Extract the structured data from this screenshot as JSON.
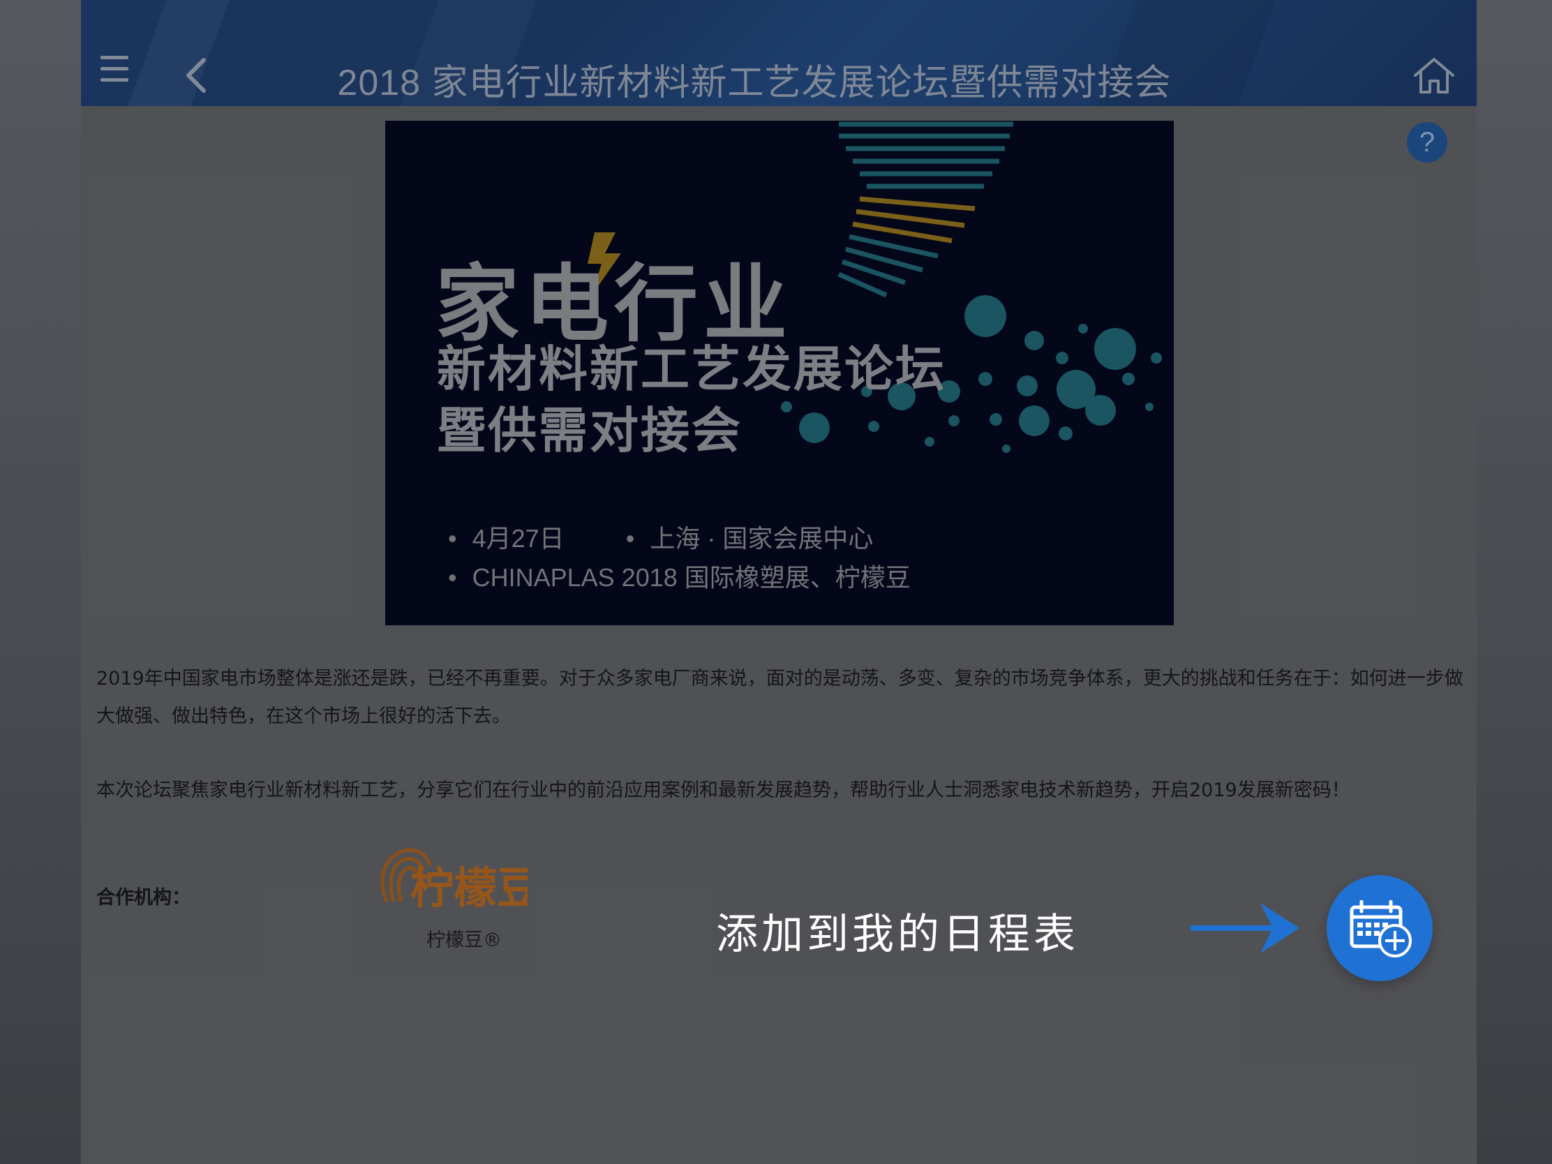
{
  "header": {
    "title": "2018 家电行业新材料新工艺发展论坛暨供需对接会",
    "menu_icon": "menu-icon",
    "back_icon": "chevron-left-icon",
    "home_icon": "home-icon"
  },
  "help": {
    "label": "?"
  },
  "banner": {
    "headline": "家电行业",
    "subline1": "新材料新工艺发展论坛",
    "subline2": "暨供需对接会",
    "date": "4月27日",
    "location": "上海 · 国家会展中心",
    "organizers": "CHINAPLAS 2018 国际橡塑展、柠檬豆",
    "bullet": "•"
  },
  "content": {
    "paragraph1": "2019年中国家电市场整体是涨还是跌，已经不再重要。对于众多家电厂商来说，面对的是动荡、多变、复杂的市场竞争体系，更大的挑战和任务在于：如何进一步做大做强、做出特色，在这个市场上很好的活下去。",
    "paragraph2": "本次论坛聚焦家电行业新材料新工艺，分享它们在行业中的前沿应用案例和最新发展趋势，帮助行业人士洞悉家电技术新趋势，开启2019发展新密码！",
    "partner_label": "合作机构：",
    "partner_logo_text": "柠檬豆",
    "partner_name": "柠檬豆®"
  },
  "overlay": {
    "hint": "添加到我的日程表",
    "fab_icon": "calendar-add-icon",
    "arrow_icon": "arrow-right-icon"
  },
  "colors": {
    "header_bg": "#1c3966",
    "fab_bg": "#1f72d4",
    "banner_bg": "#05071d",
    "logo_orange": "#b5651d"
  }
}
